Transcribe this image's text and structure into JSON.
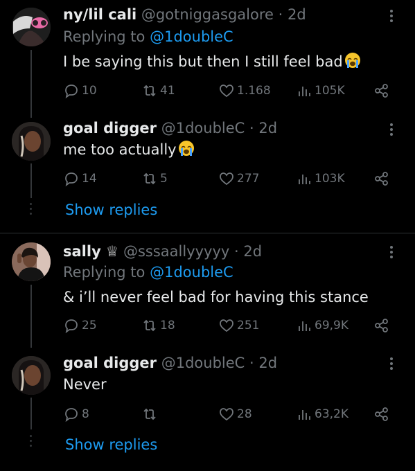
{
  "tweets": [
    {
      "name": "ny/lil cali",
      "handle": "@gotniggasgalore",
      "time": "· 2d",
      "replying_prefix": "Replying to",
      "replying_to": "@1doubleC",
      "text": "I be saying this but then I still feel bad",
      "emoji": "loudly-crying-face",
      "replies": "10",
      "reposts": "41",
      "likes": "1.168",
      "views": "105K",
      "colors": {
        "avatar_bg": "#3a2a30",
        "accent": "#e86aa6"
      }
    },
    {
      "name": "goal digger",
      "handle": "@1doubleC",
      "time": "· 2d",
      "text": "me too actually",
      "emoji": "loudly-crying-face",
      "replies": "14",
      "reposts": "5",
      "likes": "277",
      "views": "103K"
    },
    {
      "name": "sally",
      "badge": "♕",
      "handle": "@sssaallyyyyy",
      "time": "· 2d",
      "replying_prefix": "Replying to",
      "replying_to": "@1doubleC",
      "text": "& i’ll never feel bad for having this stance",
      "replies": "25",
      "reposts": "18",
      "likes": "251",
      "views": "69,9K"
    },
    {
      "name": "goal digger",
      "handle": "@1doubleC",
      "time": "· 2d",
      "text": "Never",
      "replies": "8",
      "reposts": "",
      "likes": "28",
      "views": "63,2K"
    }
  ],
  "show_replies_label": "Show replies",
  "colors": {
    "background": "#000000",
    "link": "#1d9bf0",
    "muted": "#71767b",
    "text": "#e7e9ea"
  }
}
